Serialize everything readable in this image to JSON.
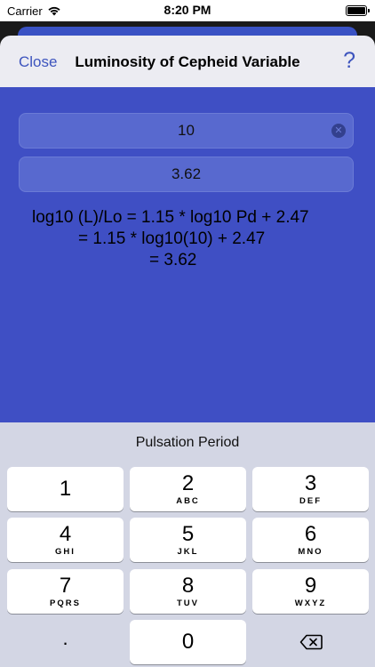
{
  "status_bar": {
    "carrier": "Carrier",
    "time": "8:20 PM",
    "wifi_icon": "wifi-icon",
    "battery_icon": "battery-icon"
  },
  "nav": {
    "close_label": "Close",
    "title": "Luminosity of Cepheid Variable",
    "help_label": "?"
  },
  "inputs": {
    "period_value": "10",
    "result_value": "3.62"
  },
  "formula": {
    "line1": "log10 (L)/Lo = 1.15 * log10 Pd + 2.47",
    "line2": "= 1.15 * log10(10) + 2.47",
    "line3": "= 3.62"
  },
  "keyboard": {
    "label": "Pulsation Period",
    "keys": [
      {
        "num": "1",
        "letters": ""
      },
      {
        "num": "2",
        "letters": "ABC"
      },
      {
        "num": "3",
        "letters": "DEF"
      },
      {
        "num": "4",
        "letters": "GHI"
      },
      {
        "num": "5",
        "letters": "JKL"
      },
      {
        "num": "6",
        "letters": "MNO"
      },
      {
        "num": "7",
        "letters": "PQRS"
      },
      {
        "num": "8",
        "letters": "TUV"
      },
      {
        "num": "9",
        "letters": "WXYZ"
      },
      {
        "num": ".",
        "letters": ""
      },
      {
        "num": "0",
        "letters": ""
      }
    ],
    "delete_icon": "backspace-icon"
  },
  "colors": {
    "accent": "#3d54be",
    "content_bg": "#3f4fc4",
    "field_bg": "#5869cf",
    "keyboard_bg": "#d3d6e4"
  }
}
